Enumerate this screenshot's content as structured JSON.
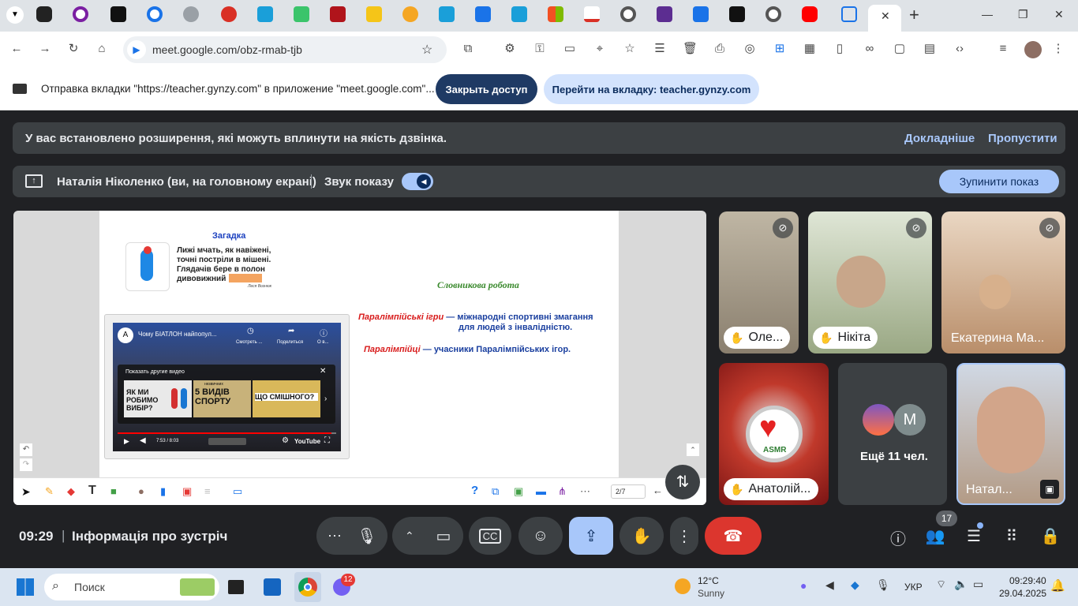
{
  "browser": {
    "url": "meet.google.com/obz-rmab-tjb",
    "window_controls": {
      "minimize": "—",
      "maximize": "❐",
      "close": "✕"
    },
    "new_tab": "+",
    "tab_close": "✕"
  },
  "sharebar": {
    "message": "Отправка вкладки \"https://teacher.gynzy.com\" в приложение \"meet.google.com\"...",
    "stop_button": "Закрыть доступ",
    "goto_button": "Перейти на вкладку: teacher.gynzy.com"
  },
  "extension_banner": {
    "text": "У вас встановлено розширення, які можуть вплинути на якість дзвінка.",
    "more_link": "Докладніше",
    "skip_link": "Пропустити"
  },
  "presenting_bar": {
    "presenter": "Наталія Ніколенко (ви, на головному екрані)",
    "sound_label": "Звук показу",
    "stop_button": "Зупинити показ"
  },
  "slide": {
    "title": "Загадка",
    "riddle_lines": [
      "Лижі мчать, як навіжені,",
      "точні постріли в мішені.",
      "Глядачів бере в полон",
      "дивовижний"
    ],
    "riddle_author": "Леся Вознюк",
    "section_title": "Словникова робота",
    "term1": "Паралімпійські ігри",
    "def1": " — міжнародні спортивні змагання",
    "def1b": "для людей з інвалідністю.",
    "term2": "Паралімпійці",
    "def2": " — учасники Паралімпійських ігор.",
    "video": {
      "title": "Чому БІАТЛОН найпопул...",
      "watch_later": "Смотреть ...",
      "share": "Поделиться",
      "info": "О в...",
      "more_videos": "Показать другие видео",
      "thumb1": "ЯК МИ РОБИМО ВИБІР?",
      "thumb2": "5 ВИДІВ СПОРТУ",
      "thumb2_small": "незвичних",
      "thumb3": "ЩО СМІШНОГО?",
      "time": "7:53 / 8:03",
      "logo": "YouTube"
    },
    "page": "2/7"
  },
  "participants": [
    {
      "name": "Оле...",
      "muted": true
    },
    {
      "name": "Нікіта",
      "muted": true
    },
    {
      "name": "Екатерина Ма...",
      "muted": true
    },
    {
      "name": "Анатолій...",
      "avatar_text": "ASMR"
    },
    {
      "name": "Ещё 11 чел.",
      "avatar_letter": "M"
    },
    {
      "name": "Натал..."
    }
  ],
  "bottom": {
    "time": "09:29",
    "separator": "|",
    "meeting_info": "Інформація про зустріч",
    "people_count": "17"
  },
  "taskbar": {
    "search": "Поиск",
    "viber_badge": "12",
    "weather_temp": "12°C",
    "weather_desc": "Sunny",
    "lang": "УКР",
    "clock_time": "09:29:40",
    "clock_date": "29.04.2025"
  }
}
